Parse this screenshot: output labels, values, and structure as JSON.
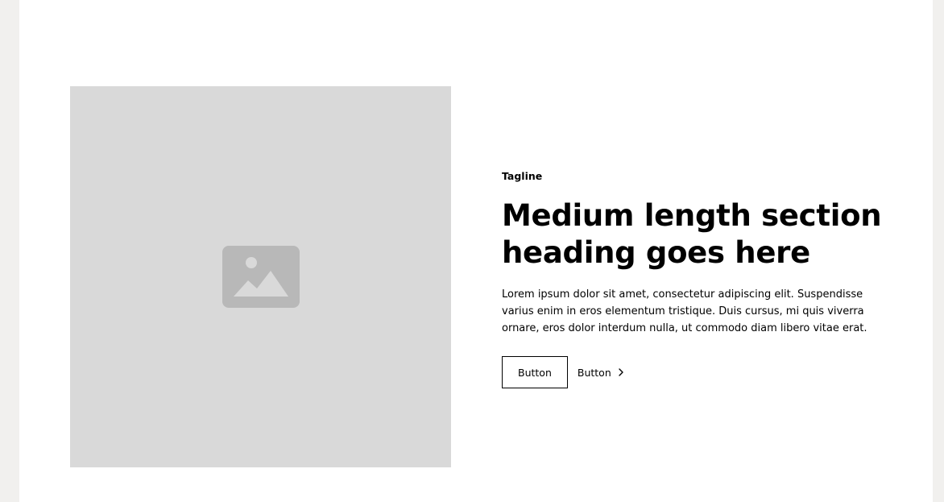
{
  "section": {
    "tagline": "Tagline",
    "heading": "Medium length section heading goes here",
    "body": "Lorem ipsum dolor sit amet, consectetur adipiscing elit. Suspendisse varius enim in eros elementum tristique. Duis cursus, mi quis viverra ornare, eros dolor interdum nulla, ut commodo diam libero vitae erat.",
    "primary_button": "Button",
    "link_button": "Button"
  },
  "icons": {
    "image_placeholder": "image-icon",
    "link_chevron": "chevron-right-icon"
  },
  "colors": {
    "page_background": "#f1f0ee",
    "section_background": "#ffffff",
    "placeholder_background": "#d9d9d9",
    "placeholder_icon": "#b8b8b8",
    "text": "#000000"
  }
}
